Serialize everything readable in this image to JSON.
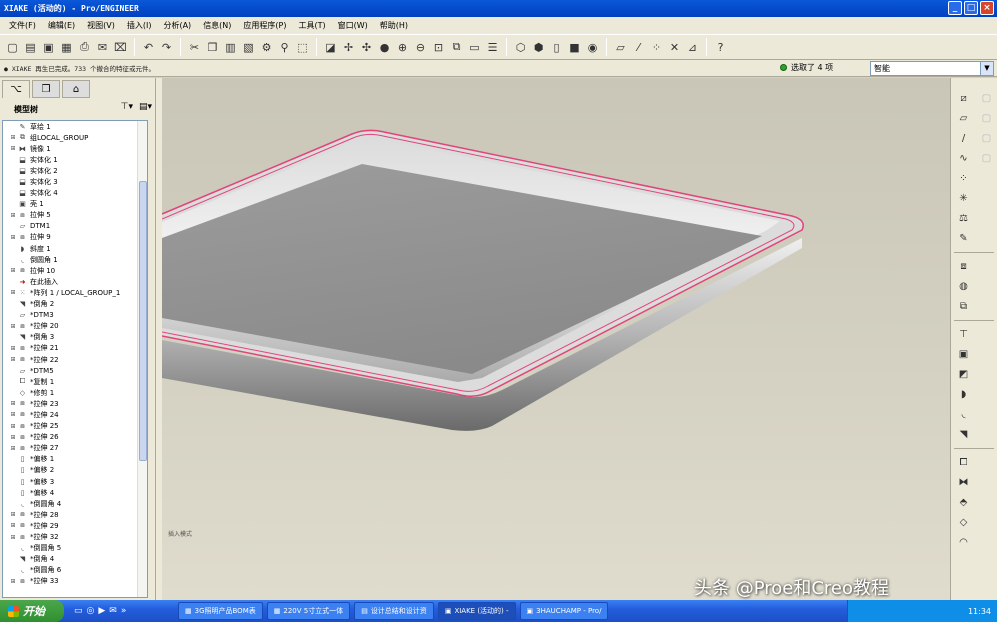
{
  "window": {
    "title": "XIAKE (活动的) - Pro/ENGINEER"
  },
  "menu": [
    "文件(F)",
    "编辑(E)",
    "视图(V)",
    "插入(I)",
    "分析(A)",
    "信息(N)",
    "应用程序(P)",
    "工具(T)",
    "窗口(W)",
    "帮助(H)"
  ],
  "message": "● XIAKE 再生已完成。733 个撤合的特征或元件。",
  "selection": {
    "count_text": "选取了 4 项",
    "filter": "智能"
  },
  "model_tree": {
    "title": "模型树",
    "items": [
      {
        "icon": "sketch-icon",
        "label": "草绘 1",
        "exp": ""
      },
      {
        "icon": "group-icon",
        "label": "组LOCAL_GROUP",
        "exp": "+"
      },
      {
        "icon": "mirror-icon",
        "label": "镜像 1",
        "exp": "+"
      },
      {
        "icon": "solidify-icon",
        "label": "实体化 1",
        "exp": ""
      },
      {
        "icon": "solidify-icon",
        "label": "实体化 2",
        "exp": ""
      },
      {
        "icon": "solidify-icon",
        "label": "实体化 3",
        "exp": ""
      },
      {
        "icon": "solidify-icon",
        "label": "实体化 4",
        "exp": ""
      },
      {
        "icon": "shell-icon",
        "label": "壳 1",
        "exp": ""
      },
      {
        "icon": "extrude-icon",
        "label": "拉伸 5",
        "exp": "+"
      },
      {
        "icon": "datum-plane-icon",
        "label": "DTM1",
        "exp": ""
      },
      {
        "icon": "extrude-icon",
        "label": "拉伸 9",
        "exp": "+"
      },
      {
        "icon": "draft-icon",
        "label": "斜度 1",
        "exp": ""
      },
      {
        "icon": "round-icon",
        "label": "倒圆角 1",
        "exp": ""
      },
      {
        "icon": "extrude-icon",
        "label": "拉伸 10",
        "exp": "+"
      },
      {
        "icon": "insert-here-icon",
        "label": "在此插入",
        "exp": "",
        "insert": true
      },
      {
        "icon": "pattern-icon",
        "label": "*阵列 1 / LOCAL_GROUP_1",
        "exp": "+"
      },
      {
        "icon": "chamfer-icon",
        "label": "*倒角 2",
        "exp": ""
      },
      {
        "icon": "datum-plane-icon",
        "label": "*DTM3",
        "exp": ""
      },
      {
        "icon": "extrude-icon",
        "label": "*拉伸 20",
        "exp": "+"
      },
      {
        "icon": "chamfer-icon",
        "label": "*倒角 3",
        "exp": ""
      },
      {
        "icon": "extrude-icon",
        "label": "*拉伸 21",
        "exp": "+"
      },
      {
        "icon": "extrude-icon",
        "label": "*拉伸 22",
        "exp": "+"
      },
      {
        "icon": "datum-plane-icon",
        "label": "*DTM5",
        "exp": ""
      },
      {
        "icon": "copy-icon",
        "label": "*复制 1",
        "exp": ""
      },
      {
        "icon": "trim-icon",
        "label": "*修剪 1",
        "exp": ""
      },
      {
        "icon": "extrude-icon",
        "label": "*拉伸 23",
        "exp": "+"
      },
      {
        "icon": "extrude-icon",
        "label": "*拉伸 24",
        "exp": "+"
      },
      {
        "icon": "extrude-icon",
        "label": "*拉伸 25",
        "exp": "+"
      },
      {
        "icon": "extrude-icon",
        "label": "*拉伸 26",
        "exp": "+"
      },
      {
        "icon": "extrude-icon",
        "label": "*拉伸 27",
        "exp": "+"
      },
      {
        "icon": "offset-icon",
        "label": "*偏移 1",
        "exp": ""
      },
      {
        "icon": "offset-icon",
        "label": "*偏移 2",
        "exp": ""
      },
      {
        "icon": "offset-icon",
        "label": "*偏移 3",
        "exp": ""
      },
      {
        "icon": "offset-icon",
        "label": "*偏移 4",
        "exp": ""
      },
      {
        "icon": "round-icon",
        "label": "*倒圆角 4",
        "exp": ""
      },
      {
        "icon": "extrude-icon",
        "label": "*拉伸 28",
        "exp": "+"
      },
      {
        "icon": "extrude-icon",
        "label": "*拉伸 29",
        "exp": "+"
      },
      {
        "icon": "extrude-icon",
        "label": "*拉伸 32",
        "exp": "+"
      },
      {
        "icon": "round-icon",
        "label": "*倒圆角 5",
        "exp": ""
      },
      {
        "icon": "chamfer-icon",
        "label": "*倒角 4",
        "exp": ""
      },
      {
        "icon": "round-icon",
        "label": "*倒圆角 6",
        "exp": ""
      },
      {
        "icon": "extrude-icon",
        "label": "*拉伸 33",
        "exp": "+"
      }
    ]
  },
  "viewport": {
    "hint": "插入模式"
  },
  "taskbar": {
    "start": "开始",
    "tasks": [
      {
        "label": "3G照明产品BOM表",
        "active": false
      },
      {
        "label": "220V 5寸立式一体",
        "active": false
      },
      {
        "label": "设计总结和设计资",
        "active": false
      },
      {
        "label": "XIAKE (活动的) -",
        "active": true
      },
      {
        "label": "3HAUCHAMP - Pro/",
        "active": false
      }
    ],
    "clock": "11:34"
  },
  "watermark": "头条 @Proe和Creo教程",
  "colors": {
    "edge_highlight": "#e0457a",
    "titlebar": "#0a58d8",
    "taskbar": "#245edc"
  }
}
